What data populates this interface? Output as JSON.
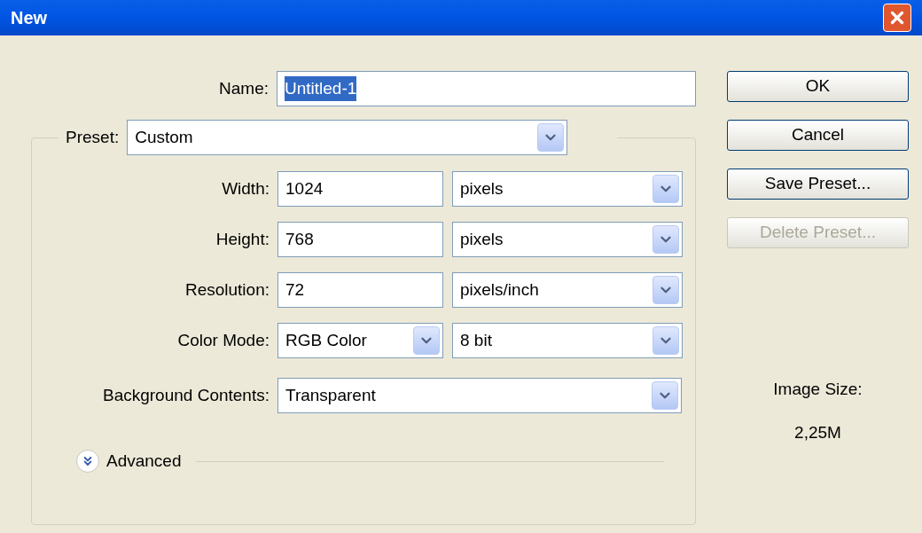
{
  "window": {
    "title": "New"
  },
  "name": {
    "label": "Name:",
    "value": "Untitled-1",
    "text_selected": true
  },
  "preset": {
    "label": "Preset:",
    "value": "Custom"
  },
  "fields": [
    {
      "label": "Width:",
      "value": "1024",
      "unit": "pixels"
    },
    {
      "label": "Height:",
      "value": "768",
      "unit": "pixels"
    },
    {
      "label": "Resolution:",
      "value": "72",
      "unit": "pixels/inch"
    }
  ],
  "color_mode": {
    "label": "Color Mode:",
    "value": "RGB Color",
    "depth": "8 bit"
  },
  "background": {
    "label": "Background Contents:",
    "value": "Transparent"
  },
  "advanced": {
    "label": "Advanced",
    "expanded": false
  },
  "buttons": [
    {
      "label": "OK",
      "disabled": false
    },
    {
      "label": "Cancel",
      "disabled": false
    },
    {
      "label": "Save Preset...",
      "disabled": false
    },
    {
      "label": "Delete Preset...",
      "disabled": true
    }
  ],
  "image_size": {
    "label": "Image Size:",
    "value": "2,25M"
  }
}
